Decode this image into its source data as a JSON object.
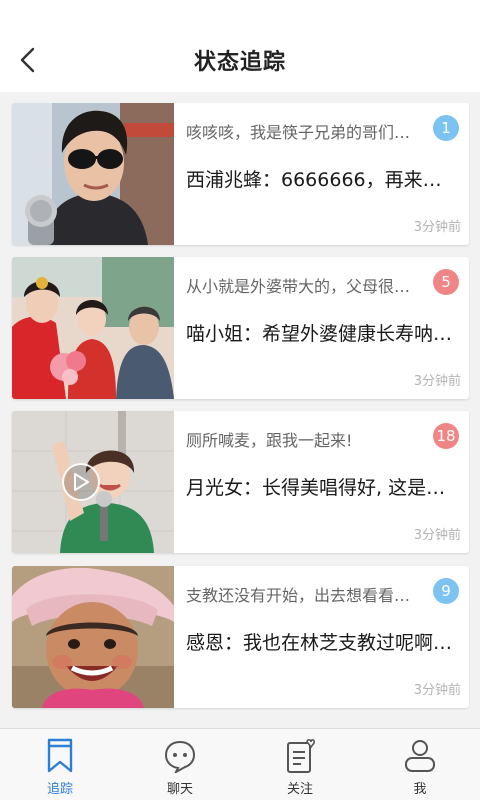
{
  "header": {
    "title": "状态追踪"
  },
  "colors": {
    "accent": "#2b7fd4",
    "badge_blue": "#7cc3f2",
    "badge_red": "#f08585"
  },
  "cards": [
    {
      "title": "咳咳咳，我是筷子兄弟的哥们…",
      "message": "西浦兆蜂：6666666，再来…",
      "badge": "1",
      "badge_color": "blue",
      "time": "3分钟前",
      "thumb_icon": "singer-with-sunglasses-photo",
      "video": false
    },
    {
      "title": "从小就是外婆带大的，父母很…",
      "message": "喵小姐：希望外婆健康长寿呐…",
      "badge": "5",
      "badge_color": "red",
      "time": "3分钟前",
      "thumb_icon": "bride-and-grandmother-photo",
      "video": false
    },
    {
      "title": "厕所喊麦，跟我一起来!",
      "message": "月光女：长得美唱得好, 这是…",
      "badge": "18",
      "badge_color": "red",
      "time": "3分钟前",
      "thumb_icon": "girl-singing-video",
      "video": true
    },
    {
      "title": "支教还没有开始，出去想看看…",
      "message": "感恩：我也在林芝支教过呢啊…",
      "badge": "9",
      "badge_color": "blue",
      "time": "3分钟前",
      "thumb_icon": "smiling-child-photo",
      "video": false
    }
  ],
  "tabs": [
    {
      "label": "追踪",
      "icon": "bookmark-icon",
      "active": true
    },
    {
      "label": "聊天",
      "icon": "chat-bubble-icon",
      "active": false
    },
    {
      "label": "关注",
      "icon": "note-heart-icon",
      "active": false
    },
    {
      "label": "我",
      "icon": "person-icon",
      "active": false
    }
  ]
}
